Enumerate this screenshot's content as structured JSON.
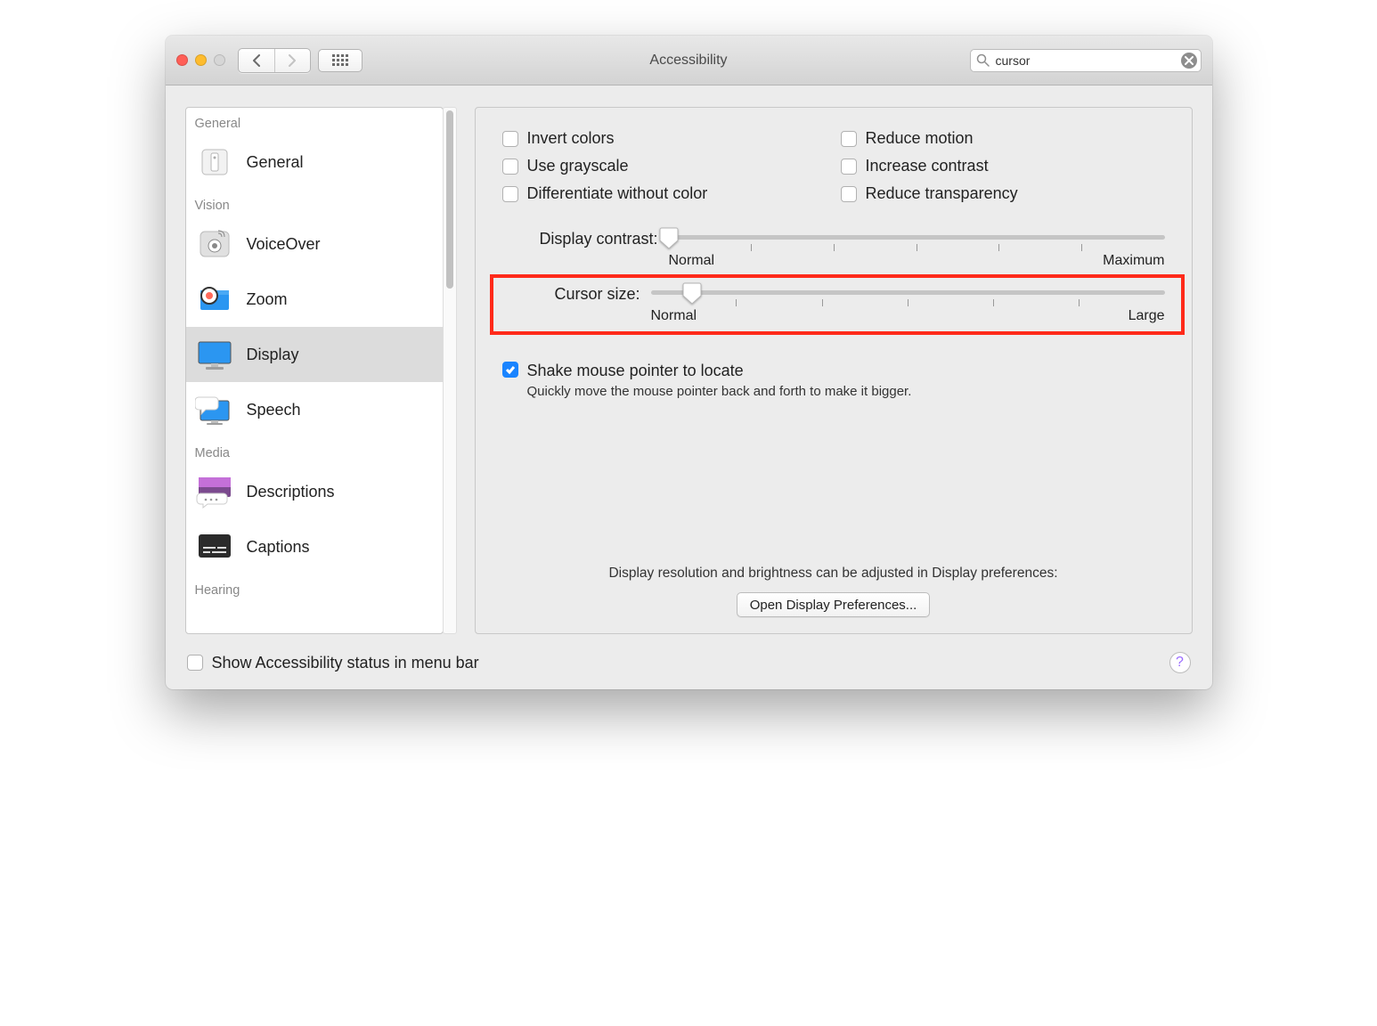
{
  "window": {
    "title": "Accessibility"
  },
  "search": {
    "value": "cursor"
  },
  "sidebar": {
    "groups": {
      "general": "General",
      "vision": "Vision",
      "media": "Media",
      "hearing": "Hearing"
    },
    "items": {
      "general": "General",
      "voiceover": "VoiceOver",
      "zoom": "Zoom",
      "display": "Display",
      "speech": "Speech",
      "descriptions": "Descriptions",
      "captions": "Captions"
    }
  },
  "checks": {
    "invert_colors": "Invert colors",
    "use_grayscale": "Use grayscale",
    "differentiate": "Differentiate without color",
    "reduce_motion": "Reduce motion",
    "increase_contrast": "Increase contrast",
    "reduce_transparency": "Reduce transparency"
  },
  "sliders": {
    "contrast": {
      "label": "Display contrast:",
      "min_caption": "Normal",
      "max_caption": "Maximum",
      "value_pct": 0
    },
    "cursor": {
      "label": "Cursor size:",
      "min_caption": "Normal",
      "max_caption": "Large",
      "value_pct": 8
    }
  },
  "shake": {
    "label": "Shake mouse pointer to locate",
    "desc": "Quickly move the mouse pointer back and forth to make it bigger.",
    "checked": true
  },
  "footer": {
    "note": "Display resolution and brightness can be adjusted in Display preferences:",
    "button": "Open Display Preferences..."
  },
  "bottom": {
    "label": "Show Accessibility status in menu bar",
    "checked": false
  }
}
